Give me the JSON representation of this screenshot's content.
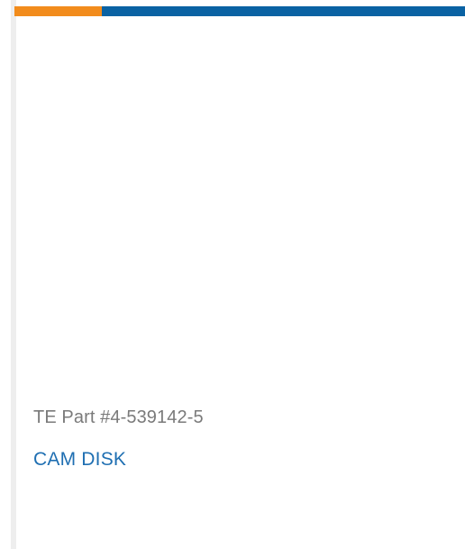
{
  "product": {
    "part_number": "TE Part #4-539142-5",
    "name": "CAM DISK"
  },
  "colors": {
    "accent_orange": "#f28c1c",
    "accent_blue": "#0a62a3",
    "link": "#1f6fb2",
    "muted_text": "#7a7a7a"
  }
}
